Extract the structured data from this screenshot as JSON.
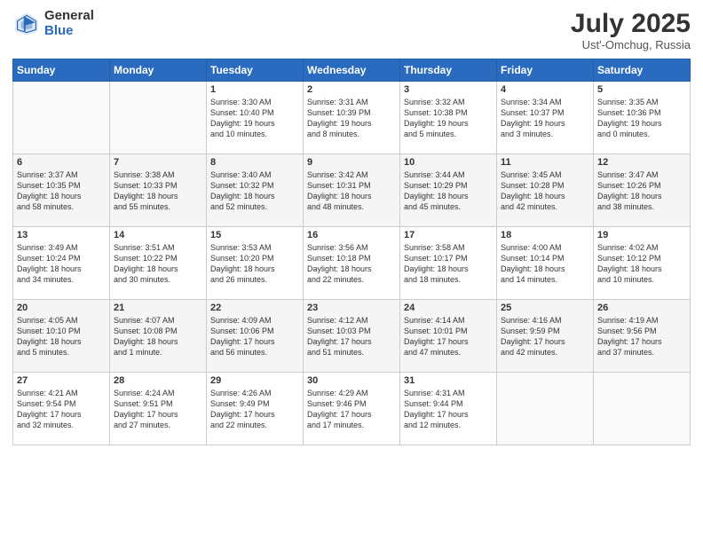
{
  "header": {
    "logo_general": "General",
    "logo_blue": "Blue",
    "month_title": "July 2025",
    "location": "Ust'-Omchug, Russia"
  },
  "weekdays": [
    "Sunday",
    "Monday",
    "Tuesday",
    "Wednesday",
    "Thursday",
    "Friday",
    "Saturday"
  ],
  "weeks": [
    [
      {
        "day": "",
        "info": ""
      },
      {
        "day": "",
        "info": ""
      },
      {
        "day": "1",
        "info": "Sunrise: 3:30 AM\nSunset: 10:40 PM\nDaylight: 19 hours\nand 10 minutes."
      },
      {
        "day": "2",
        "info": "Sunrise: 3:31 AM\nSunset: 10:39 PM\nDaylight: 19 hours\nand 8 minutes."
      },
      {
        "day": "3",
        "info": "Sunrise: 3:32 AM\nSunset: 10:38 PM\nDaylight: 19 hours\nand 5 minutes."
      },
      {
        "day": "4",
        "info": "Sunrise: 3:34 AM\nSunset: 10:37 PM\nDaylight: 19 hours\nand 3 minutes."
      },
      {
        "day": "5",
        "info": "Sunrise: 3:35 AM\nSunset: 10:36 PM\nDaylight: 19 hours\nand 0 minutes."
      }
    ],
    [
      {
        "day": "6",
        "info": "Sunrise: 3:37 AM\nSunset: 10:35 PM\nDaylight: 18 hours\nand 58 minutes."
      },
      {
        "day": "7",
        "info": "Sunrise: 3:38 AM\nSunset: 10:33 PM\nDaylight: 18 hours\nand 55 minutes."
      },
      {
        "day": "8",
        "info": "Sunrise: 3:40 AM\nSunset: 10:32 PM\nDaylight: 18 hours\nand 52 minutes."
      },
      {
        "day": "9",
        "info": "Sunrise: 3:42 AM\nSunset: 10:31 PM\nDaylight: 18 hours\nand 48 minutes."
      },
      {
        "day": "10",
        "info": "Sunrise: 3:44 AM\nSunset: 10:29 PM\nDaylight: 18 hours\nand 45 minutes."
      },
      {
        "day": "11",
        "info": "Sunrise: 3:45 AM\nSunset: 10:28 PM\nDaylight: 18 hours\nand 42 minutes."
      },
      {
        "day": "12",
        "info": "Sunrise: 3:47 AM\nSunset: 10:26 PM\nDaylight: 18 hours\nand 38 minutes."
      }
    ],
    [
      {
        "day": "13",
        "info": "Sunrise: 3:49 AM\nSunset: 10:24 PM\nDaylight: 18 hours\nand 34 minutes."
      },
      {
        "day": "14",
        "info": "Sunrise: 3:51 AM\nSunset: 10:22 PM\nDaylight: 18 hours\nand 30 minutes."
      },
      {
        "day": "15",
        "info": "Sunrise: 3:53 AM\nSunset: 10:20 PM\nDaylight: 18 hours\nand 26 minutes."
      },
      {
        "day": "16",
        "info": "Sunrise: 3:56 AM\nSunset: 10:18 PM\nDaylight: 18 hours\nand 22 minutes."
      },
      {
        "day": "17",
        "info": "Sunrise: 3:58 AM\nSunset: 10:17 PM\nDaylight: 18 hours\nand 18 minutes."
      },
      {
        "day": "18",
        "info": "Sunrise: 4:00 AM\nSunset: 10:14 PM\nDaylight: 18 hours\nand 14 minutes."
      },
      {
        "day": "19",
        "info": "Sunrise: 4:02 AM\nSunset: 10:12 PM\nDaylight: 18 hours\nand 10 minutes."
      }
    ],
    [
      {
        "day": "20",
        "info": "Sunrise: 4:05 AM\nSunset: 10:10 PM\nDaylight: 18 hours\nand 5 minutes."
      },
      {
        "day": "21",
        "info": "Sunrise: 4:07 AM\nSunset: 10:08 PM\nDaylight: 18 hours\nand 1 minute."
      },
      {
        "day": "22",
        "info": "Sunrise: 4:09 AM\nSunset: 10:06 PM\nDaylight: 17 hours\nand 56 minutes."
      },
      {
        "day": "23",
        "info": "Sunrise: 4:12 AM\nSunset: 10:03 PM\nDaylight: 17 hours\nand 51 minutes."
      },
      {
        "day": "24",
        "info": "Sunrise: 4:14 AM\nSunset: 10:01 PM\nDaylight: 17 hours\nand 47 minutes."
      },
      {
        "day": "25",
        "info": "Sunrise: 4:16 AM\nSunset: 9:59 PM\nDaylight: 17 hours\nand 42 minutes."
      },
      {
        "day": "26",
        "info": "Sunrise: 4:19 AM\nSunset: 9:56 PM\nDaylight: 17 hours\nand 37 minutes."
      }
    ],
    [
      {
        "day": "27",
        "info": "Sunrise: 4:21 AM\nSunset: 9:54 PM\nDaylight: 17 hours\nand 32 minutes."
      },
      {
        "day": "28",
        "info": "Sunrise: 4:24 AM\nSunset: 9:51 PM\nDaylight: 17 hours\nand 27 minutes."
      },
      {
        "day": "29",
        "info": "Sunrise: 4:26 AM\nSunset: 9:49 PM\nDaylight: 17 hours\nand 22 minutes."
      },
      {
        "day": "30",
        "info": "Sunrise: 4:29 AM\nSunset: 9:46 PM\nDaylight: 17 hours\nand 17 minutes."
      },
      {
        "day": "31",
        "info": "Sunrise: 4:31 AM\nSunset: 9:44 PM\nDaylight: 17 hours\nand 12 minutes."
      },
      {
        "day": "",
        "info": ""
      },
      {
        "day": "",
        "info": ""
      }
    ]
  ]
}
